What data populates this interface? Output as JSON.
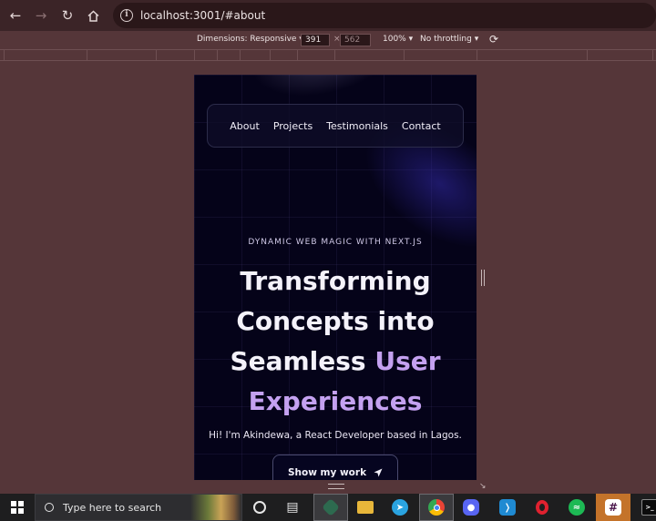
{
  "browser": {
    "url": "localhost:3001/#about"
  },
  "devtools": {
    "dimensions_label": "Dimensions: Responsive",
    "width": "391",
    "separator": "×",
    "height": "562",
    "zoom": "100%",
    "throttling": "No throttling"
  },
  "site": {
    "nav": [
      "About",
      "Projects",
      "Testimonials",
      "Contact"
    ],
    "eyebrow": "DYNAMIC WEB MAGIC WITH NEXT.JS",
    "headline_line1": "Transforming",
    "headline_line2": "Concepts into",
    "headline_line3": "Seamless",
    "headline_accent1": "User",
    "headline_accent2": "Experiences",
    "intro": "Hi! I'm Akindewa, a React Developer based in Lagos.",
    "cta_label": "Show my work",
    "accent_color": "#c4a1f0",
    "background_color": "#050319"
  },
  "taskbar": {
    "search_placeholder": "Type here to search",
    "pinned": [
      "task-view",
      "file-explorer",
      "git-app",
      "folders",
      "telegram",
      "chrome",
      "discord",
      "vscode",
      "opera",
      "spotify",
      "slack",
      "terminal"
    ]
  }
}
